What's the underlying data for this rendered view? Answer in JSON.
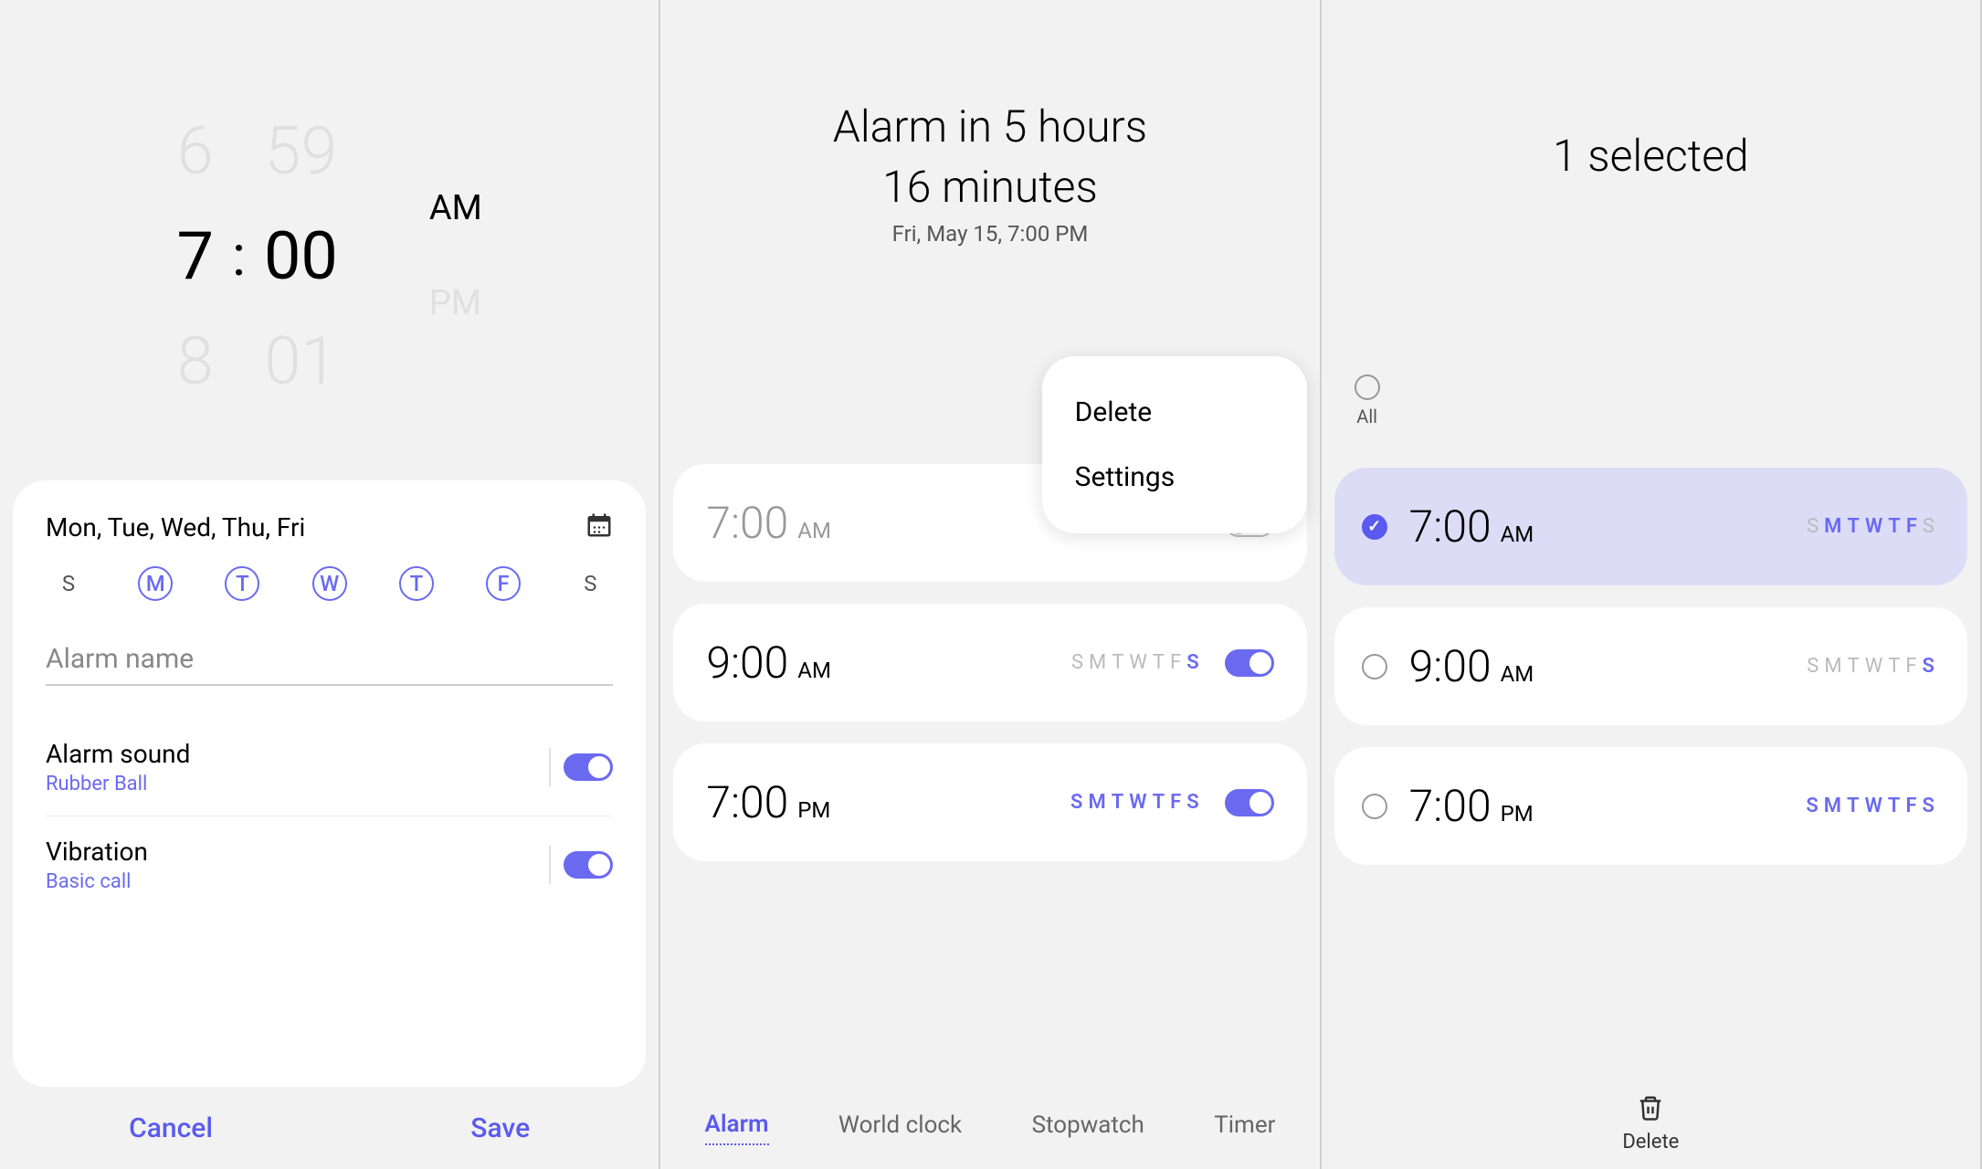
{
  "pane1": {
    "hour_prev": "6",
    "hour_sel": "7",
    "hour_next": "8",
    "min_prev": "59",
    "min_sel": "00",
    "min_next": "01",
    "am": "AM",
    "pm": "PM",
    "days_summary": "Mon, Tue, Wed, Thu, Fri",
    "days": [
      "S",
      "M",
      "T",
      "W",
      "T",
      "F",
      "S"
    ],
    "name_placeholder": "Alarm name",
    "sound_label": "Alarm sound",
    "sound_value": "Rubber Ball",
    "vib_label": "Vibration",
    "vib_value": "Basic call",
    "cancel": "Cancel",
    "save": "Save"
  },
  "pane2": {
    "header_line1": "Alarm in 5 hours",
    "header_line2": "16 minutes",
    "header_sub": "Fri, May 15, 7:00 PM",
    "menu_delete": "Delete",
    "menu_settings": "Settings",
    "alarms": [
      {
        "time": "7:00",
        "period": "AM",
        "dim": true,
        "on": false,
        "days": [
          false,
          true,
          true,
          true,
          true,
          true,
          false
        ]
      },
      {
        "time": "9:00",
        "period": "AM",
        "dim": false,
        "on": true,
        "days": [
          false,
          false,
          false,
          false,
          false,
          false,
          true
        ]
      },
      {
        "time": "7:00",
        "period": "PM",
        "dim": false,
        "on": true,
        "days": [
          true,
          true,
          true,
          true,
          true,
          true,
          true
        ]
      }
    ],
    "tabs": [
      "Alarm",
      "World clock",
      "Stopwatch",
      "Timer"
    ]
  },
  "pane3": {
    "title": "1 selected",
    "all_label": "All",
    "alarms": [
      {
        "time": "7:00",
        "period": "AM",
        "checked": true,
        "days": [
          false,
          true,
          true,
          true,
          true,
          true,
          false
        ]
      },
      {
        "time": "9:00",
        "period": "AM",
        "checked": false,
        "days": [
          false,
          false,
          false,
          false,
          false,
          false,
          true
        ]
      },
      {
        "time": "7:00",
        "period": "PM",
        "checked": false,
        "days": [
          true,
          true,
          true,
          true,
          true,
          true,
          true
        ]
      }
    ],
    "delete_label": "Delete"
  },
  "day_letters": [
    "S",
    "M",
    "T",
    "W",
    "T",
    "F",
    "S"
  ]
}
